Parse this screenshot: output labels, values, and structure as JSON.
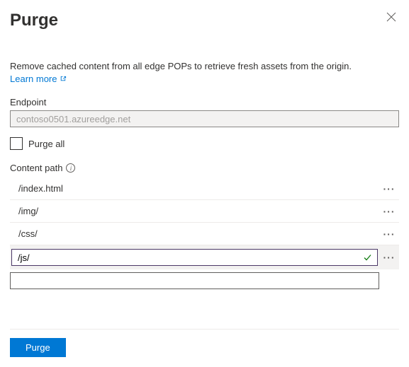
{
  "header": {
    "title": "Purge"
  },
  "description": "Remove cached content from all edge POPs to retrieve fresh assets from the origin.",
  "learn_more": "Learn more",
  "endpoint": {
    "label": "Endpoint",
    "value": "contoso0501.azureedge.net"
  },
  "purge_all": {
    "label": "Purge all",
    "checked": false
  },
  "content_path": {
    "label": "Content path",
    "items": [
      {
        "value": "/index.html",
        "editing": false
      },
      {
        "value": "/img/",
        "editing": false
      },
      {
        "value": "/css/",
        "editing": false
      },
      {
        "value": "/js/",
        "editing": true,
        "valid": true
      }
    ],
    "empty_value": ""
  },
  "footer": {
    "purge_button": "Purge"
  }
}
